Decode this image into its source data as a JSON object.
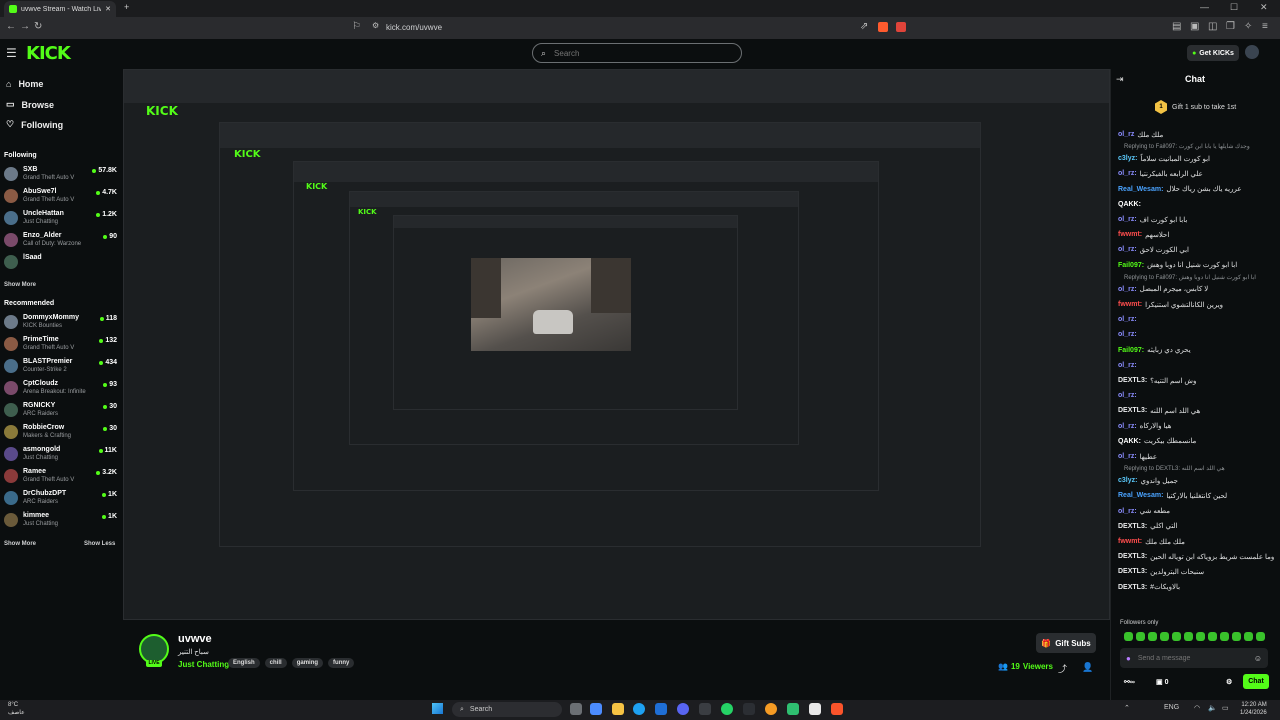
{
  "browser": {
    "tab_title": "uvwve Stream - Watch Live on K",
    "url": "kick.com/uvwve",
    "new_tab": "+"
  },
  "header": {
    "logo": "KICK",
    "search_placeholder": "Search",
    "get_kicks": "Get KICKs"
  },
  "sidebar": {
    "nav": [
      {
        "label": "Home",
        "icon": "home-icon"
      },
      {
        "label": "Browse",
        "icon": "browse-icon"
      },
      {
        "label": "Following",
        "icon": "heart-icon"
      }
    ],
    "following_title": "Following",
    "following": [
      {
        "name": "SXB",
        "game": "Grand Theft Auto V",
        "viewers": "57.8K"
      },
      {
        "name": "AbuSwe7l",
        "game": "Grand Theft Auto V",
        "viewers": "4.7K"
      },
      {
        "name": "UncleHattan",
        "game": "Just Chatting",
        "viewers": "1.2K"
      },
      {
        "name": "Enzo_Alder",
        "game": "Call of Duty: Warzone",
        "viewers": "90"
      },
      {
        "name": "lSaad",
        "game": "",
        "viewers": ""
      }
    ],
    "show_more": "Show More",
    "recommended_title": "Recommended",
    "recommended": [
      {
        "name": "DommyxMommy",
        "game": "KICK Bounties",
        "viewers": "118"
      },
      {
        "name": "PrimeTime",
        "game": "Grand Theft Auto V",
        "viewers": "132"
      },
      {
        "name": "BLASTPremier",
        "game": "Counter-Strike 2",
        "viewers": "434"
      },
      {
        "name": "CptCloudz",
        "game": "Arena Breakout: Infinite",
        "viewers": "93"
      },
      {
        "name": "RGNICKY",
        "game": "ARC Raiders",
        "viewers": "30"
      },
      {
        "name": "RobbieCrow",
        "game": "Makers & Crafting",
        "viewers": "30"
      },
      {
        "name": "asmongold",
        "game": "Just Chatting",
        "viewers": "11K"
      },
      {
        "name": "Ramee",
        "game": "Grand Theft Auto V",
        "viewers": "3.2K"
      },
      {
        "name": "DrChubzDPT",
        "game": "ARC Raiders",
        "viewers": "1K"
      },
      {
        "name": "kimmee",
        "game": "Just Chatting",
        "viewers": "1K"
      }
    ],
    "show_less": "Show Less"
  },
  "channel": {
    "name": "uvwve",
    "title": "سباح التنير",
    "category": "Just Chatting",
    "tags": [
      "English",
      "chill",
      "gaming",
      "funny"
    ],
    "live_badge": "LIVE",
    "gift_subs": "Gift Subs",
    "viewers": "19",
    "viewers_label": "Viewers"
  },
  "chat": {
    "title": "Chat",
    "pinned_text": "Gift 1 sub to take 1st",
    "pinned_badge": "1",
    "messages": [
      {
        "type": "msg",
        "user": "ol_rz",
        "text": "ملك ملك",
        "color": "#8a8dff"
      },
      {
        "type": "reply",
        "text": "Replying to Fail097: وجدك شايلها يا بابا ابن كورت"
      },
      {
        "type": "msg",
        "user": "c3lyz:",
        "text": "ابو كورت المبانيت سلاماً",
        "color": "#5ac8fa"
      },
      {
        "type": "msg",
        "user": "ol_rz:",
        "text": "علي الرابعه بالفيكرنتيا",
        "color": "#8a8dff"
      },
      {
        "type": "msg",
        "user": "Real_Wesam:",
        "text": "عرريه ياك بشن رياك حلال",
        "color": "#4aa3ff"
      },
      {
        "type": "msg",
        "user": "QAKK:",
        "text": "",
        "color": "#ffffff"
      },
      {
        "type": "msg",
        "user": "ol_rz:",
        "text": "بابا ابو كورت اف",
        "color": "#8a8dff"
      },
      {
        "type": "msg",
        "user": "fwwmt:",
        "text": "احلاسهم",
        "color": "#ff4d4d"
      },
      {
        "type": "msg",
        "user": "ol_rz:",
        "text": "ابي الكورت لاحق",
        "color": "#8a8dff"
      },
      {
        "type": "msg",
        "user": "Fail097:",
        "text": "ابا ابو كورت شنيل انا دوبا وهش",
        "color": "#53fc18"
      },
      {
        "type": "reply",
        "text": "Replying to Fail097: ابا ابو كورت شنيل انا دوبا وهش"
      },
      {
        "type": "msg",
        "user": "ol_rz:",
        "text": "لا كابس، ميجرم المبصل",
        "color": "#8a8dff"
      },
      {
        "type": "msg",
        "user": "fwwmt:",
        "text": "ويرين الكانالتشوي استنيكرا",
        "color": "#ff4d4d"
      },
      {
        "type": "msg",
        "user": "ol_rz:",
        "text": "",
        "color": "#8a8dff"
      },
      {
        "type": "msg",
        "user": "ol_rz:",
        "text": "",
        "color": "#8a8dff"
      },
      {
        "type": "msg",
        "user": "Fail097:",
        "text": "يحري دي زبايثه",
        "color": "#53fc18"
      },
      {
        "type": "msg",
        "user": "ol_rz:",
        "text": "",
        "color": "#8a8dff"
      },
      {
        "type": "msg",
        "user": "DEXTL3:",
        "text": "وش اسم التتيه؟",
        "color": "#e9eaeb"
      },
      {
        "type": "msg",
        "user": "ol_rz:",
        "text": "",
        "color": "#8a8dff"
      },
      {
        "type": "msg",
        "user": "DEXTL3:",
        "text": "هي اللد اسم اللنه",
        "color": "#e9eaeb"
      },
      {
        "type": "msg",
        "user": "ol_rz:",
        "text": "هيا والاركاه",
        "color": "#8a8dff"
      },
      {
        "type": "msg",
        "user": "QAKK:",
        "text": "مانسمطك بيكريت",
        "color": "#ffffff"
      },
      {
        "type": "msg",
        "user": "ol_rz:",
        "text": "عطيها",
        "color": "#8a8dff"
      },
      {
        "type": "reply",
        "text": "Replying to DEXTL3: هي اللد اسم اللنه"
      },
      {
        "type": "msg",
        "user": "c3lyz:",
        "text": "جميل واندوي",
        "color": "#5ac8fa"
      },
      {
        "type": "msg",
        "user": "Real_Wesam:",
        "text": "لحين كانتغلنيا بالاركتيا",
        "color": "#4aa3ff"
      },
      {
        "type": "msg",
        "user": "ol_rz:",
        "text": "مطعه شي",
        "color": "#8a8dff"
      },
      {
        "type": "msg",
        "user": "DEXTL3:",
        "text": "التي اكلي",
        "color": "#e9eaeb"
      },
      {
        "type": "msg",
        "user": "fwwmt:",
        "text": "ملك ملك ملك",
        "color": "#ff4d4d"
      },
      {
        "type": "msg",
        "user": "DEXTL3:",
        "text": "وما علمست شريط بزوياكه ابن توياله الحين",
        "color": "#e9eaeb"
      },
      {
        "type": "msg",
        "user": "DEXTL3:",
        "text": "سنبحات البترولدين",
        "color": "#e9eaeb"
      },
      {
        "type": "msg",
        "user": "DEXTL3:",
        "text": "#بالاويكات",
        "color": "#e9eaeb"
      }
    ],
    "followers_only": "Followers only",
    "send_placeholder": "Send a message",
    "chat_button": "Chat",
    "foot_count_a": "0",
    "foot_count_b": "0"
  },
  "taskbar": {
    "weather_temp": "8°C",
    "weather_desc": "عاصف",
    "search": "Search",
    "lang": "ENG",
    "time": "12:20 AM",
    "date": "1/24/2026"
  }
}
